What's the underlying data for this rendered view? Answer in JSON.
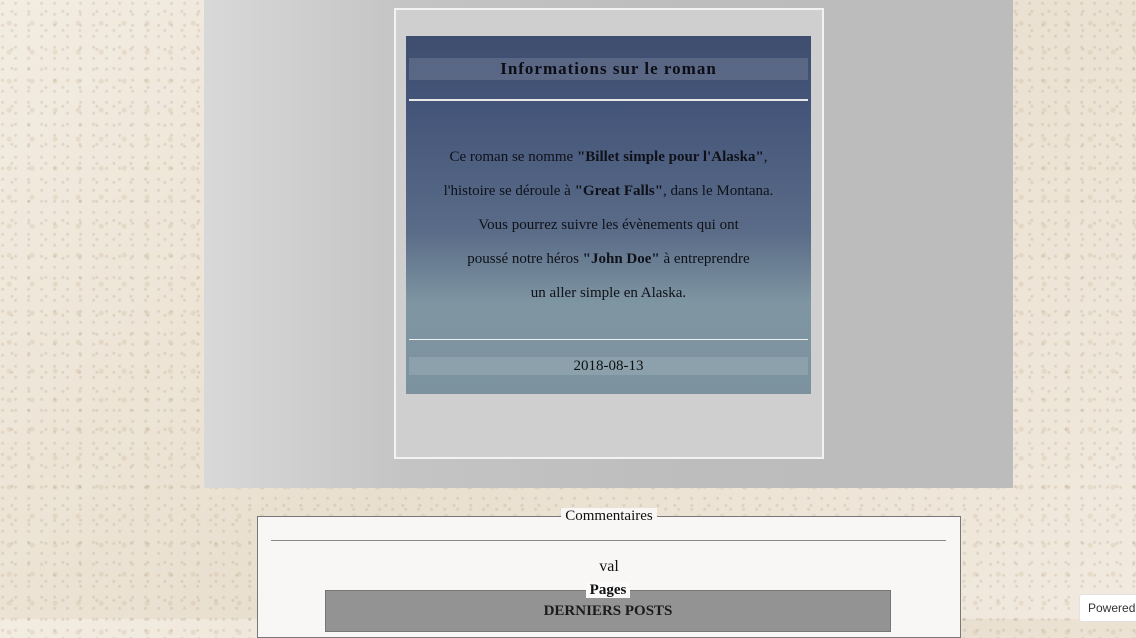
{
  "novel_card": {
    "title": "Informations sur le roman",
    "lines": [
      {
        "pre": "Ce roman se nomme ",
        "bold": "\"Billet simple pour l'Alaska\"",
        "post": ","
      },
      {
        "pre": "l'histoire se déroule à ",
        "bold": "\"Great Falls\"",
        "post": ", dans le Montana."
      },
      {
        "pre": "Vous pourrez suivre les évènements qui ont",
        "bold": "",
        "post": ""
      },
      {
        "pre": "poussé notre héros ",
        "bold": "\"John Doe\"",
        "post": " à entreprendre"
      },
      {
        "pre": "un aller simple en Alaska.",
        "bold": "",
        "post": ""
      }
    ],
    "date": "2018-08-13"
  },
  "comments": {
    "legend": "Commentaires",
    "author": "val",
    "pages": {
      "legend": "Pages",
      "heading": "DERNIERS POSTS"
    }
  },
  "footer": {
    "powered_label": "Powered"
  }
}
